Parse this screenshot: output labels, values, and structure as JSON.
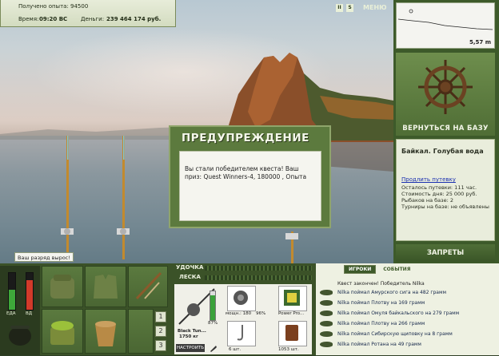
{
  "info": {
    "experience": "Получено опыта: 94500",
    "time_label": "Время:",
    "time_value": "09:20 ВС",
    "money_label": "Деньги:",
    "money_value": "239 464 174 руб."
  },
  "menu": {
    "pause_label": "II",
    "sound_label": "S",
    "menu_label": "МЕНЮ"
  },
  "map": {
    "depth": "5,57 m"
  },
  "return_button": "ВЕРНУТЬСЯ НА БАЗУ",
  "location": {
    "title": "Байкал. Голубая вода",
    "extend_link": "Продлить путевку",
    "remaining": "Осталось путевки: 111 час.",
    "day_cost": "Стоимость дня: 25 000 руб.",
    "anglers": "Рыбаков на базе: 2",
    "tournaments": "Турниры на базе: не объявлены"
  },
  "bans_button": "ЗАПРЕТЫ",
  "dialog": {
    "title": "ПРЕДУПРЕЖДЕНИЕ",
    "message": "Вы стали победителем квеста! Ваш приз: Quest Winners-4, 180000 , Опыта"
  },
  "rank_popup": "Ваш разряд вырос!",
  "gauges": {
    "food_label": "ЕДА",
    "health_label": "ВД",
    "food_level": 0.55,
    "health_level": 0.8
  },
  "rod": {
    "rod_label": "УДОЧКА",
    "line_label": "ЛЕСКА",
    "rod_name": "Black Tun...",
    "rod_weight": "1750 кг",
    "rod_percent": "87%",
    "setup_button": "НАСТРОИТЬ",
    "reel_info": "мощн.: 180",
    "reel_percent": "96%",
    "bait_name": "Power Pro...",
    "hook_count": "6 шт.",
    "bait_weight": "1053 шт."
  },
  "slots": {
    "numbers": [
      "1",
      "2",
      "3"
    ]
  },
  "chat": {
    "tab_players": "ИГРОКИ",
    "tab_events": "СОБЫТИЯ",
    "header": "Квест закончен! Победитель Nilka",
    "lines": [
      "Nilka поймал Амурского сига на 482 грамм",
      "Nilka поймал Плотву на 169 грамм",
      "Nilka поймал Омуля байкальского на 279 грамм",
      "Nilka поймал Плотву на 266 грамм",
      "Nilka поймал Сибирскую щиповку на 8 грамм",
      "Nilka поймал Ротана на 49 грамм"
    ]
  },
  "colors": {
    "panel_green": "#3d5a2a",
    "dialog_green": "#5c7a3e",
    "chat_text": "#15274a"
  }
}
